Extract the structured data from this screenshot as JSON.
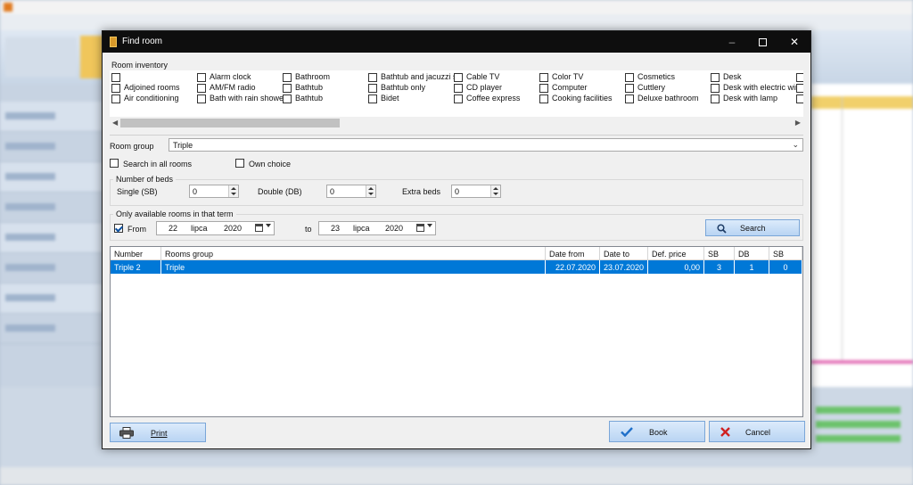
{
  "dialog": {
    "title": "Find room",
    "window_controls": {
      "minimize": "–",
      "close": "✕"
    }
  },
  "inventory": {
    "label": "Room inventory",
    "columns": [
      [
        "",
        "Adjoined rooms",
        "Air conditioning"
      ],
      [
        "Alarm clock",
        "AM/FM radio",
        "Bath with rain shower"
      ],
      [
        "Bathroom",
        "Bathtub",
        "Bathtub"
      ],
      [
        "Bathtub and jacuzzi s",
        "Bathtub only",
        "Bidet"
      ],
      [
        "Cable TV",
        "CD player",
        "Coffee express"
      ],
      [
        "Color TV",
        "Computer",
        "Cooking facilities"
      ],
      [
        "Cosmetics",
        "Cuttlery",
        "Deluxe bathroom"
      ],
      [
        "Desk",
        "Desk with electric win",
        "Desk with lamp"
      ],
      [
        "",
        "",
        ""
      ]
    ]
  },
  "room_group": {
    "label": "Room group",
    "value": "Triple"
  },
  "search_all": {
    "label": "Search in all rooms",
    "checked": false
  },
  "own_choice": {
    "label": "Own choice",
    "checked": false
  },
  "beds": {
    "title": "Number of beds",
    "single_label": "Single (SB)",
    "single_value": "0",
    "double_label": "Double (DB)",
    "double_value": "0",
    "extra_label": "Extra beds",
    "extra_value": "0"
  },
  "term": {
    "title": "Only available rooms in that term",
    "from_label": "From",
    "from_checked": true,
    "from_day": "22",
    "from_month": "lipca",
    "from_year": "2020",
    "to_label": "to",
    "to_day": "23",
    "to_month": "lipca",
    "to_year": "2020",
    "search_label": "Search"
  },
  "results": {
    "columns": [
      "Number",
      "Rooms group",
      "Date from",
      "Date to",
      "Def. price",
      "SB",
      "DB",
      "SB"
    ],
    "rows": [
      {
        "number": "Triple 2",
        "group": "Triple",
        "date_from": "22.07.2020",
        "date_to": "23.07.2020",
        "price": "0,00",
        "sb": "3",
        "db": "1",
        "sb2": "0"
      }
    ]
  },
  "footer": {
    "print_label": "Print",
    "book_label": "Book",
    "cancel_label": "Cancel"
  },
  "icons": {
    "print": "printer-icon",
    "search": "magnifier-icon",
    "book": "checkmark-icon",
    "cancel": "x-icon"
  },
  "colors": {
    "selection": "#0078d7",
    "titlebar": "#0e0e0e",
    "button_blue": "#b9d4f3",
    "cancel_red": "#d02020",
    "book_blue": "#1f6fc9"
  }
}
